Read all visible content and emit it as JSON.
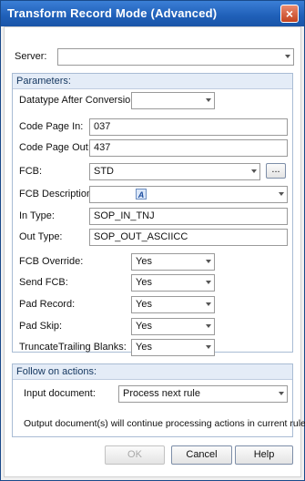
{
  "window": {
    "title": "Transform Record Mode (Advanced)",
    "close_glyph": "×"
  },
  "server": {
    "label": "Server:",
    "value": ""
  },
  "parameters": {
    "heading": "Parameters:",
    "datatype": {
      "label": "Datatype After Conversion:",
      "value": ""
    },
    "code_page_in": {
      "label": "Code Page In:",
      "value": "037"
    },
    "code_page_out": {
      "label": "Code Page Out:",
      "value": "437"
    },
    "fcb": {
      "label": "FCB:",
      "value": "STD",
      "browse_label": "..."
    },
    "fcb_description": {
      "label": "FCB Description:",
      "value": ""
    },
    "in_type": {
      "label": "In Type:",
      "value": "SOP_IN_TNJ"
    },
    "out_type": {
      "label": "Out Type:",
      "value": "SOP_OUT_ASCIICC"
    },
    "fcb_override": {
      "label": "FCB Override:",
      "value": "Yes"
    },
    "send_fcb": {
      "label": "Send FCB:",
      "value": "Yes"
    },
    "pad_record": {
      "label": "Pad Record:",
      "value": "Yes"
    },
    "pad_skip": {
      "label": "Pad Skip:",
      "value": "Yes"
    },
    "truncate_trailing_blanks": {
      "label": "TruncateTrailing Blanks:",
      "value": "Yes"
    }
  },
  "follow_on": {
    "heading": "Follow on actions:",
    "input_document": {
      "label": "Input document:",
      "value": "Process next rule"
    },
    "info_text": "Output document(s) will continue processing actions in current rule."
  },
  "buttons": {
    "ok": "OK",
    "cancel": "Cancel",
    "help": "Help"
  }
}
